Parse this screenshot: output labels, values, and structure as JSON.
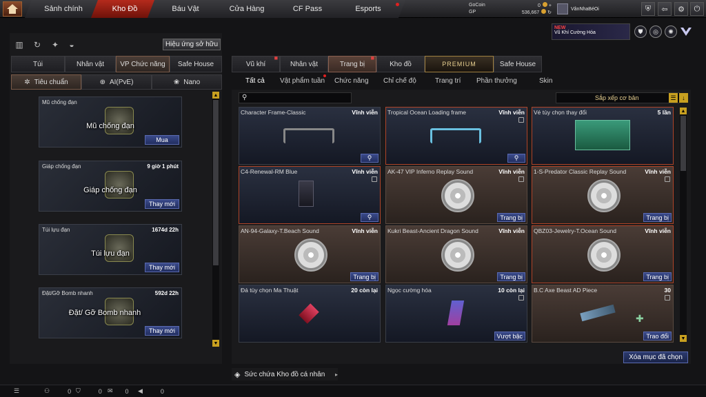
{
  "nav": {
    "tabs": [
      {
        "label": "Sảnh chính"
      },
      {
        "label": "Kho Đồ"
      },
      {
        "label": "Báu Vật"
      },
      {
        "label": "Cửa Hàng"
      },
      {
        "label": "CF Pass"
      },
      {
        "label": "Esports"
      }
    ],
    "active_tab": "Kho Đồ"
  },
  "currency": {
    "gocoin_label": "GoCoin",
    "gocoin_value": "0",
    "gp_label": "GP",
    "gp_value": "536,667"
  },
  "user": {
    "name": "VânNhaBéOi"
  },
  "banner": {
    "new_label": "NEW",
    "text": "Vũ Khí Cường Hóa"
  },
  "left": {
    "effect_button": "Hiệu ứng sở hữu",
    "tabs": [
      "Túi",
      "Nhân vật",
      "VP Chức năng",
      "Safe House"
    ],
    "subtabs": [
      "Tiêu chuẩn",
      "AI(PvE)",
      "Nano"
    ],
    "items": [
      {
        "name": "Mũ chống đạn",
        "time": "",
        "big": "Mũ chống đạn",
        "action": "Mua"
      },
      {
        "name": "Giáp chống đạn",
        "time": "9 giờ 1 phút",
        "big": "Giáp chống đạn",
        "action": "Thay mới"
      },
      {
        "name": "Túi lựu đạn",
        "time": "1674d 22h",
        "big": "Túi lựu đạn",
        "action": "Thay mới"
      },
      {
        "name": "Đặt/Gỡ Bomb nhanh",
        "time": "592d 22h",
        "big": "Đặt/ Gỡ Bomb nhanh",
        "action": "Thay mới"
      }
    ]
  },
  "right": {
    "tabs": [
      "Vũ khí",
      "Nhân vật",
      "Trang bị",
      "Kho đồ",
      "PREMIUM",
      "Safe House"
    ],
    "filters": [
      "Tất cả",
      "Vật phẩm tuần",
      "Chức năng",
      "Chỉ chế độ",
      "Trang trí",
      "Phần thưởng",
      "Skin"
    ],
    "sort_label": "Sắp xếp cơ bản",
    "items": [
      {
        "name": "Character Frame-Classic",
        "time": "Vĩnh viễn",
        "action": ""
      },
      {
        "name": "Tropical Ocean Loading frame",
        "time": "Vĩnh viễn",
        "action": ""
      },
      {
        "name": "Vé tùy chọn thay đổi",
        "time": "5 lần",
        "action": ""
      },
      {
        "name": "C4-Renewal-RM Blue",
        "time": "Vĩnh viễn",
        "action": ""
      },
      {
        "name": "AK-47 VIP Inferno Replay Sound",
        "time": "Vĩnh viễn",
        "action": "Trang bị"
      },
      {
        "name": "1-S-Predator Classic Replay Sound",
        "time": "Vĩnh viễn",
        "action": "Trang bị"
      },
      {
        "name": "AN-94-Galaxy-T.Beach Sound",
        "time": "Vĩnh viễn",
        "action": "Trang bị"
      },
      {
        "name": "Kukri Beast-Ancient Dragon Sound",
        "time": "Vĩnh viễn",
        "action": "Trang bị"
      },
      {
        "name": "QBZ03-Jewelry-T.Ocean Sound",
        "time": "Vĩnh viễn",
        "action": "Trang bị"
      },
      {
        "name": "Đá tùy chọn Ma Thuật",
        "time": "20 còn lại",
        "action": ""
      },
      {
        "name": "Ngọc cường hóa",
        "time": "10 còn lại",
        "action": "Vượt bậc"
      },
      {
        "name": "B.C Axe Beast AD Piece",
        "time": "30",
        "action": "Trao đổi"
      }
    ],
    "delete_button": "Xóa mục đã chọn"
  },
  "footer": {
    "repair_label": "Sức chứa Kho đồ cá nhân",
    "stats": [
      "0",
      "0",
      "0",
      "0"
    ]
  }
}
